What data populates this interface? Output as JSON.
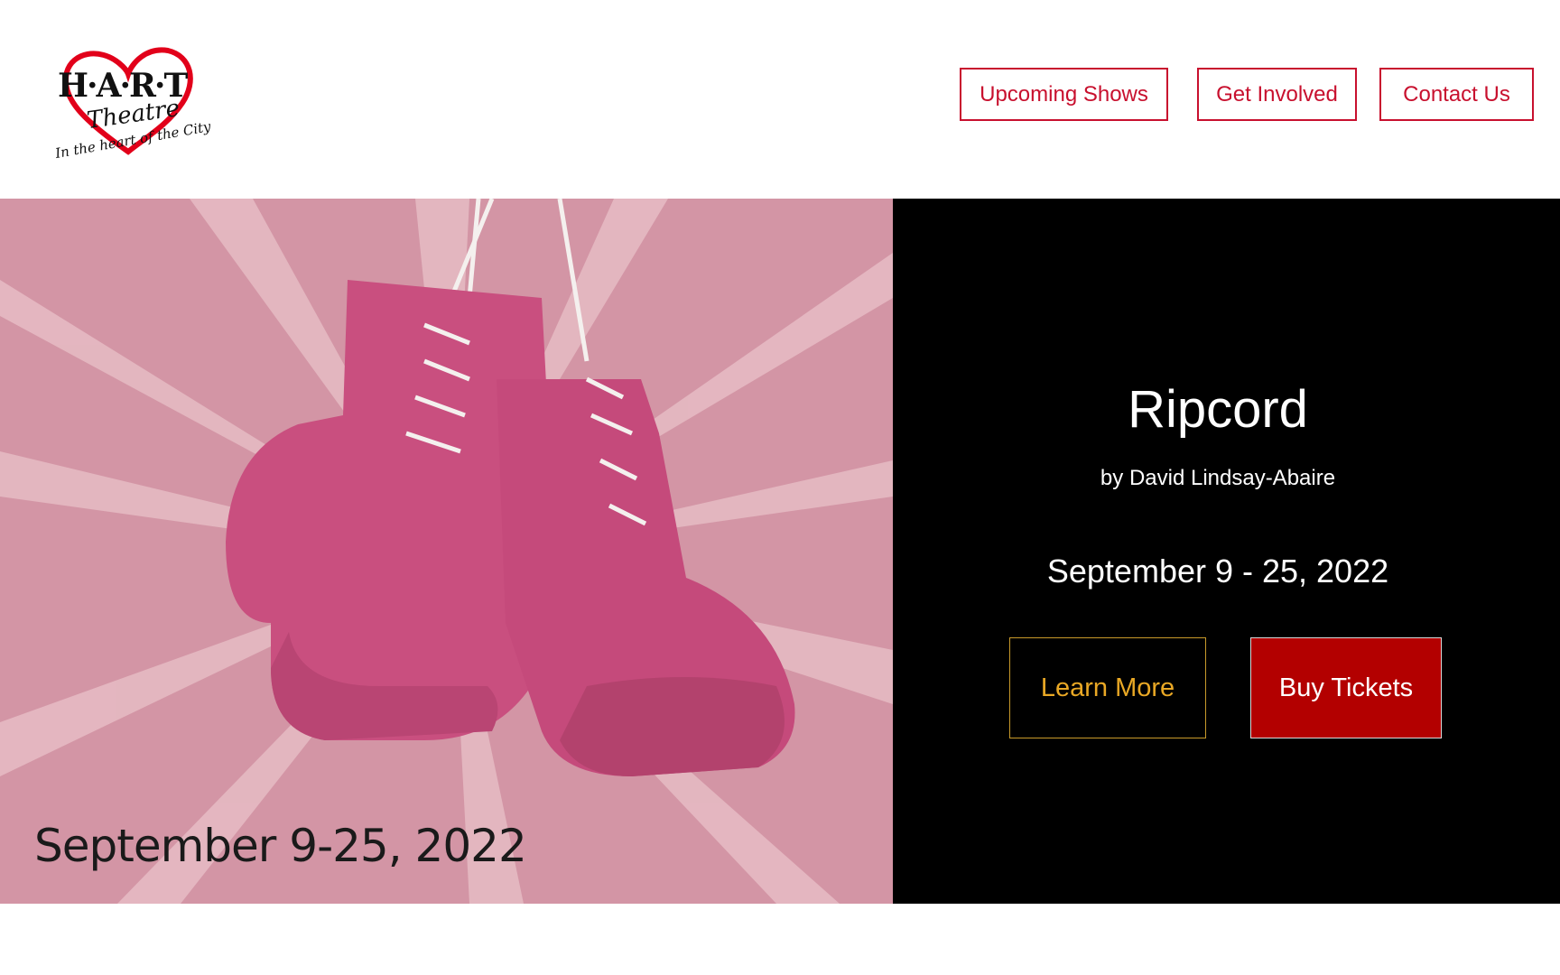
{
  "header": {
    "logo": {
      "main_text": "H·A·R·T",
      "sub_text": "Theatre",
      "tagline": "In the heart of the City",
      "icon": "heart-icon",
      "color": "#e2001a"
    },
    "nav": [
      {
        "label": "Upcoming Shows"
      },
      {
        "label": "Get Involved"
      },
      {
        "label": "Contact Us"
      }
    ]
  },
  "hero": {
    "image": {
      "description_icon": "boxing-gloves-image",
      "date_text": "September 9-25, 2022",
      "background_color": "#d395a5",
      "glove_color": "#c94f7f"
    },
    "title": "Ripcord",
    "author": "by David Lindsay-Abaire",
    "dates": "September 9 - 25, 2022",
    "learn_more_label": "Learn More",
    "buy_tickets_label": "Buy Tickets"
  },
  "colors": {
    "accent_red": "#c8102e",
    "buy_button": "#b30000",
    "learn_more_gold": "#e9a825",
    "panel": "#000000"
  }
}
